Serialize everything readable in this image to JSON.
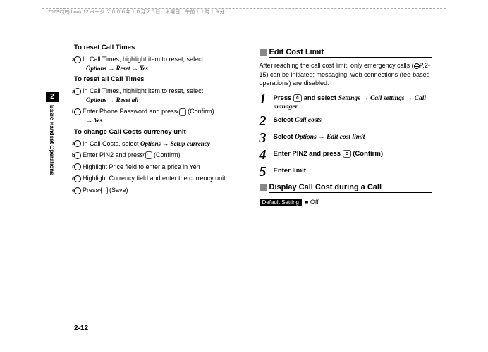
{
  "header": "707SC(E).book  12 ページ  ２００６年１０月２６日　木曜日　午前１１時１９分",
  "side": {
    "chapter": "2",
    "label": "Basic Handset Operations"
  },
  "left": {
    "h1": "To reset Call Times",
    "h1_steps": [
      {
        "n": "a",
        "pre": "In Call Times, highlight item to reset, select ",
        "it": "Options → Reset → Yes"
      }
    ],
    "h2": "To reset all Call Times",
    "h2_steps": [
      {
        "n": "a",
        "pre": "In Call Times, highlight item to reset, select ",
        "it": "Options → Reset all"
      },
      {
        "n": "b",
        "pre": "Enter Phone Password and press ",
        "key": "c",
        "post": " (Confirm) ",
        "it": "→ Yes"
      }
    ],
    "h3": "To change Call Costs currency unit",
    "h3_steps": [
      {
        "n": "a",
        "pre": "In Call Costs, select ",
        "it": "Options → Setup currency"
      },
      {
        "n": "b",
        "pre": "Enter PIN2 and press ",
        "key": "c",
        "post": " (Confirm)"
      },
      {
        "n": "c",
        "pre": "Highlight Price field to enter a price in Yen"
      },
      {
        "n": "d",
        "pre": "Highlight Currency field and enter the currency unit."
      },
      {
        "n": "e",
        "pre": "Press ",
        "key": "w",
        "post": " (Save)"
      }
    ]
  },
  "right": {
    "sec1_title": "Edit Cost Limit",
    "sec1_para_a": "After reaching the call cost limit, only emergency calls (",
    "sec1_para_ref": "P.2-15",
    "sec1_para_b": ") can be initiated; messaging, web connections (fee-based operations) are disabled.",
    "steps": [
      {
        "n": "1",
        "pre": "Press ",
        "key": "c",
        "mid": " and select ",
        "it": "Settings → Call settings → Call manager"
      },
      {
        "n": "2",
        "pre": "Select ",
        "it": "Call costs"
      },
      {
        "n": "3",
        "pre": "Select ",
        "it": "Options → Edit cost limit"
      },
      {
        "n": "4",
        "pre": "Enter PIN2 and press ",
        "key": "c",
        "post": " (Confirm)"
      },
      {
        "n": "5",
        "pre": "Enter limit"
      }
    ],
    "sec2_title": "Display Call Cost during a Call",
    "default_label": "Default Setting",
    "default_value": "■ Off"
  },
  "page_number": "2-12"
}
